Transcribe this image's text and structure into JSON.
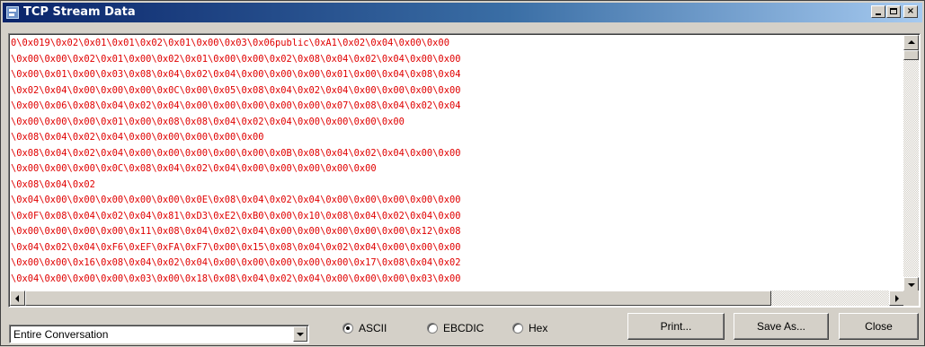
{
  "window": {
    "title": "TCP Stream Data",
    "app_icon": "wireshark-window-icon",
    "controls": {
      "minimize": "minimize-icon",
      "maximize": "maximize-icon",
      "close": "close-icon",
      "close_glyph": "×"
    }
  },
  "stream": {
    "text_color": "#e00000",
    "lines": [
      "0\\0x019\\0x02\\0x01\\0x01\\0x02\\0x01\\0x00\\0x03\\0x06public\\0xA1\\0x02\\0x04\\0x00\\0x00",
      "\\0x00\\0x00\\0x02\\0x01\\0x00\\0x02\\0x01\\0x00\\0x00\\0x02\\0x08\\0x04\\0x02\\0x04\\0x00\\0x00",
      "\\0x00\\0x01\\0x00\\0x03\\0x08\\0x04\\0x02\\0x04\\0x00\\0x00\\0x00\\0x01\\0x00\\0x04\\0x08\\0x04",
      "\\0x02\\0x04\\0x00\\0x00\\0x00\\0x0C\\0x00\\0x05\\0x08\\0x04\\0x02\\0x04\\0x00\\0x00\\0x00\\0x00",
      "\\0x00\\0x06\\0x08\\0x04\\0x02\\0x04\\0x00\\0x00\\0x00\\0x00\\0x00\\0x07\\0x08\\0x04\\0x02\\0x04",
      "\\0x00\\0x00\\0x00\\0x01\\0x00\\0x08\\0x08\\0x04\\0x02\\0x04\\0x00\\0x00\\0x00\\0x00",
      "\\0x08\\0x04\\0x02\\0x04\\0x00\\0x00\\0x00\\0x00\\0x00",
      "\\0x08\\0x04\\0x02\\0x04\\0x00\\0x00\\0x00\\0x00\\0x00\\0x0B\\0x08\\0x04\\0x02\\0x04\\0x00\\0x00",
      "\\0x00\\0x00\\0x00\\0x0C\\0x08\\0x04\\0x02\\0x04\\0x00\\0x00\\0x00\\0x00\\0x00",
      "\\0x08\\0x04\\0x02",
      "\\0x04\\0x00\\0x00\\0x00\\0x00\\0x00\\0x0E\\0x08\\0x04\\0x02\\0x04\\0x00\\0x00\\0x00\\0x00\\0x00",
      "\\0x0F\\0x08\\0x04\\0x02\\0x04\\0x81\\0xD3\\0xE2\\0xB0\\0x00\\0x10\\0x08\\0x04\\0x02\\0x04\\0x00",
      "\\0x00\\0x00\\0x00\\0x00\\0x11\\0x08\\0x04\\0x02\\0x04\\0x00\\0x00\\0x00\\0x00\\0x00\\0x12\\0x08",
      "\\0x04\\0x02\\0x04\\0xF6\\0xEF\\0xFA\\0xF7\\0x00\\0x15\\0x08\\0x04\\0x02\\0x04\\0x00\\0x00\\0x00",
      "\\0x00\\0x00\\0x16\\0x08\\0x04\\0x02\\0x04\\0x00\\0x00\\0x00\\0x00\\0x00\\0x17\\0x08\\0x04\\0x02",
      "\\0x04\\0x00\\0x00\\0x00\\0x03\\0x00\\0x18\\0x08\\0x04\\0x02\\0x04\\0x00\\0x00\\0x00\\0x03\\0x00"
    ]
  },
  "controls": {
    "conversation_select": {
      "value": "Entire Conversation"
    },
    "format": {
      "options": [
        "ASCII",
        "EBCDIC",
        "Hex"
      ],
      "selected": "ASCII"
    },
    "buttons": {
      "print": "Print...",
      "save_as": "Save As...",
      "close": "Close"
    }
  }
}
